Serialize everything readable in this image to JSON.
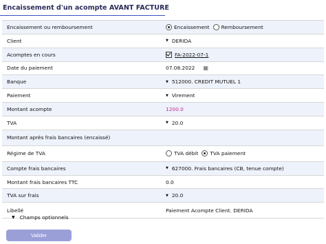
{
  "title": "Encaissement d'un acompte AVANT FACTURE",
  "rows": [
    {
      "label": "Encaissement ou remboursement",
      "opt1": "Encaissement",
      "opt2": "Remboursement"
    },
    {
      "label": "Client",
      "value": "DERIDA"
    },
    {
      "label": "Acomptes en cours",
      "value": "FA-2022-07-1"
    },
    {
      "label": "Date du paiement",
      "value": "07.08.2022"
    },
    {
      "label": "Banque",
      "value": "512000. CREDIT MUTUEL 1"
    },
    {
      "label": "Paiement",
      "value": "Virement"
    },
    {
      "label": "Montant acompte",
      "value": "1200.0"
    },
    {
      "label": "TVA",
      "value": "20.0"
    },
    {
      "label": "Montant après frais bancaires (encaissé)",
      "value": ""
    },
    {
      "label": "Régime de TVA",
      "opt1": "TVA débit",
      "opt2": "TVA paiement"
    },
    {
      "label": "Compte frais bancaires",
      "value": "627000. Frais bancaires (CB, tenue compte)"
    },
    {
      "label": "Montant frais bancaires TTC",
      "value": "0.0"
    },
    {
      "label": "TVA sur frais",
      "value": "20.0"
    },
    {
      "label": "Libellé",
      "value": "Paiement Acompte Client. DERIDA"
    }
  ],
  "optional_fields": "Champs optionnels",
  "submit_label": "Valider",
  "colors": {
    "accent": "#3a4ec2",
    "button": "#9b9fd8",
    "amount": "#c02a92",
    "row_alt": "#eef2fb"
  }
}
